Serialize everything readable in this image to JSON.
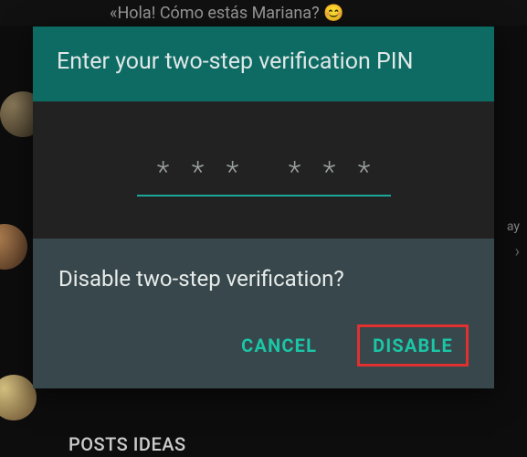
{
  "background": {
    "header_text": "«Hola! Cómo estás Mariana? 😊",
    "right_tag": "ay",
    "right_chevron": "›",
    "bottom_title": "POSTS IDEAS"
  },
  "dialog": {
    "title": "Enter your two-step verification PIN",
    "pin_mask_char": "✱",
    "pin_digits": [
      "*",
      "*",
      "*",
      "*",
      "*",
      "*"
    ]
  },
  "confirm": {
    "title": "Disable two-step verification?",
    "cancel_label": "CANCEL",
    "disable_label": "DISABLE"
  },
  "colors": {
    "accent": "#1bc6a6",
    "header_bg": "#0d6b63",
    "highlight_border": "#e03030"
  }
}
